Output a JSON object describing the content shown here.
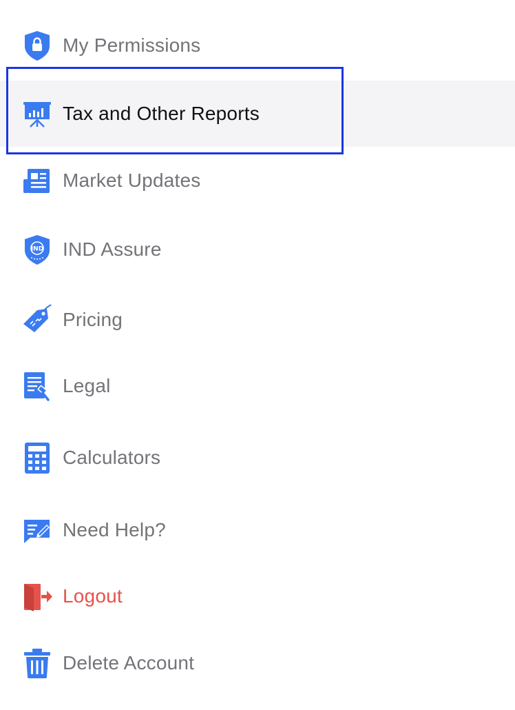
{
  "colors": {
    "icon_blue": "#3b7bf0",
    "label_gray": "#737378",
    "label_active": "#111114",
    "logout_red": "#e5524b",
    "highlight_bg": "#f4f4f6",
    "focus_border": "#1a36e0"
  },
  "menu": {
    "items": [
      {
        "label": "My Permissions",
        "icon": "shield-lock-icon"
      },
      {
        "label": "Tax and Other Reports",
        "icon": "presentation-chart-icon",
        "selected": true
      },
      {
        "label": "Market Updates",
        "icon": "newspaper-icon"
      },
      {
        "label": "IND Assure",
        "icon": "ind-shield-icon",
        "icon_text": "IND"
      },
      {
        "label": "Pricing",
        "icon": "price-tag-icon"
      },
      {
        "label": "Legal",
        "icon": "legal-document-icon"
      },
      {
        "label": "Calculators",
        "icon": "calculator-icon"
      },
      {
        "label": "Need Help?",
        "icon": "chat-edit-icon"
      },
      {
        "label": "Logout",
        "icon": "logout-door-icon"
      },
      {
        "label": "Delete Account",
        "icon": "trash-icon"
      }
    ]
  }
}
